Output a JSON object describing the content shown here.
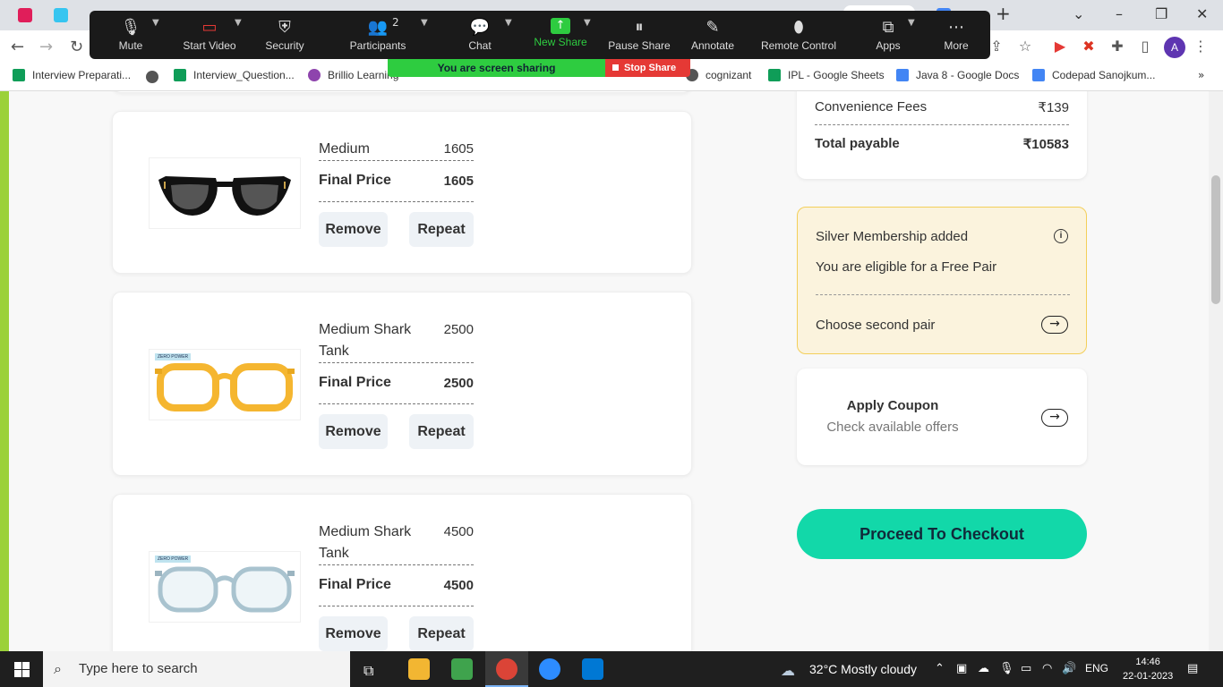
{
  "zoom": {
    "items": [
      {
        "label": "Mute",
        "icon": "microphone-icon"
      },
      {
        "label": "Start Video",
        "icon": "video-off-icon"
      },
      {
        "label": "Security",
        "icon": "shield-icon"
      },
      {
        "label": "Participants",
        "icon": "participants-icon",
        "count": "2"
      },
      {
        "label": "Chat",
        "icon": "chat-icon"
      },
      {
        "label": "New Share",
        "icon": "share-up-icon"
      },
      {
        "label": "Pause Share",
        "icon": "pause-icon"
      },
      {
        "label": "Annotate",
        "icon": "pencil-icon"
      },
      {
        "label": "Remote Control",
        "icon": "mouse-icon"
      },
      {
        "label": "Apps",
        "icon": "apps-icon"
      },
      {
        "label": "More",
        "icon": "more-icon"
      }
    ],
    "sharing_text": "You are screen sharing",
    "stop_share": "Stop Share",
    "colors": {
      "bar": "#1a1a1a",
      "new_share": "#2ecc40",
      "stop": "#e53935"
    }
  },
  "browser": {
    "avatar_letter": "A"
  },
  "bookmarks": [
    "Interview Preparati...",
    "Interview_Question...",
    "Brillio Learning",
    "cognizant",
    "IPL - Google Sheets",
    "Java 8 - Google Docs",
    "Codepad Sanojkum..."
  ],
  "cart": {
    "items": [
      {
        "name": "Medium",
        "price": "1605",
        "final_label": "Final Price",
        "final_price": "1605",
        "remove": "Remove",
        "repeat": "Repeat",
        "frame": "black-cat-eye",
        "badge": ""
      },
      {
        "name": "Medium Shark Tank",
        "price": "2500",
        "final_label": "Final Price",
        "final_price": "2500",
        "remove": "Remove",
        "repeat": "Repeat",
        "frame": "yellow",
        "badge": "ZERO POWER"
      },
      {
        "name": "Medium Shark Tank",
        "price": "4500",
        "final_label": "Final Price",
        "final_price": "4500",
        "remove": "Remove",
        "repeat": "Repeat",
        "frame": "clear-blue",
        "badge": "ZERO POWER"
      }
    ]
  },
  "summary": {
    "convenience_label": "Convenience Fees",
    "convenience_value": "₹139",
    "total_label": "Total payable",
    "total_value": "₹10583"
  },
  "membership": {
    "title": "Silver Membership added",
    "subtitle": "You are eligible for a Free Pair",
    "choose": "Choose second pair"
  },
  "coupon": {
    "title": "Apply Coupon",
    "subtitle": "Check available offers"
  },
  "checkout_label": "Proceed To Checkout",
  "taskbar": {
    "search_placeholder": "Type here to search",
    "weather": "32°C  Mostly cloudy",
    "lang": "ENG",
    "time": "14:46",
    "date": "22-01-2023"
  }
}
